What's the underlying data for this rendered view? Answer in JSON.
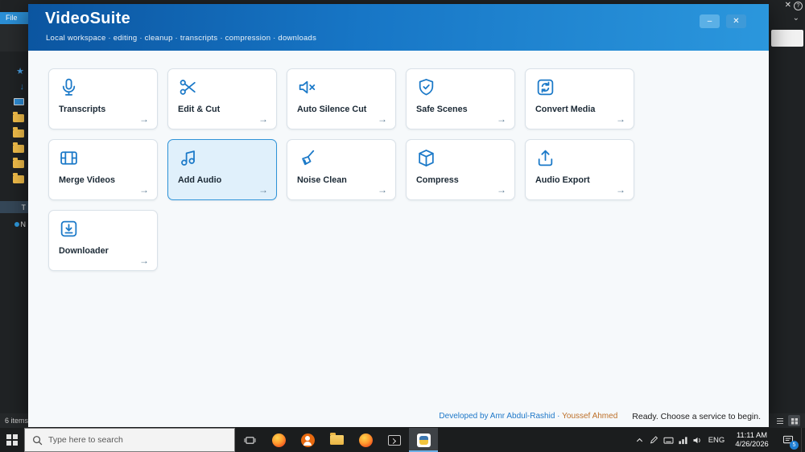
{
  "explorer": {
    "file_tab": "File",
    "items_count": "6 items",
    "tree_letters": [
      "T",
      "N"
    ],
    "close": "✕",
    "help": "?",
    "ribbon_chevron": "⌄"
  },
  "window": {
    "title": "VideoSuite",
    "subtitle": "Local workspace · editing · cleanup · transcripts · compression · downloads",
    "minimize": "–",
    "close": "✕"
  },
  "services": [
    {
      "label": "Transcripts",
      "icon": "microphone-icon",
      "selected": false
    },
    {
      "label": "Edit & Cut",
      "icon": "scissors-icon",
      "selected": false
    },
    {
      "label": "Auto Silence Cut",
      "icon": "mute-speaker-icon",
      "selected": false
    },
    {
      "label": "Safe Scenes",
      "icon": "shield-icon",
      "selected": false
    },
    {
      "label": "Convert Media",
      "icon": "convert-icon",
      "selected": false
    },
    {
      "label": "Merge Videos",
      "icon": "filmstrip-icon",
      "selected": false
    },
    {
      "label": "Add Audio",
      "icon": "music-note-icon",
      "selected": true
    },
    {
      "label": "Noise Clean",
      "icon": "broom-icon",
      "selected": false
    },
    {
      "label": "Compress",
      "icon": "package-icon",
      "selected": false
    },
    {
      "label": "Audio Export",
      "icon": "export-icon",
      "selected": false
    },
    {
      "label": "Downloader",
      "icon": "download-icon",
      "selected": false
    }
  ],
  "icons": {
    "arrow": "→",
    "star": "★",
    "down_arrow": "↓"
  },
  "footer": {
    "credits_prefix": "Developed by Amr Abdul-Rashid",
    "credits_separator": "·",
    "credits_author": "Youssef Ahmed",
    "status": "Ready. Choose a service to begin."
  },
  "taskbar": {
    "search_placeholder": "Type here to search",
    "language": "ENG",
    "time": "11:11 AM",
    "date": "4/26/2026",
    "badge": "5"
  },
  "colors": {
    "accent": "#1b79c8",
    "header_gradient_start": "#0b55a0",
    "header_gradient_end": "#2b97dd",
    "selected_card_bg": "#e0f0fb",
    "selected_card_border": "#2e93d8"
  }
}
